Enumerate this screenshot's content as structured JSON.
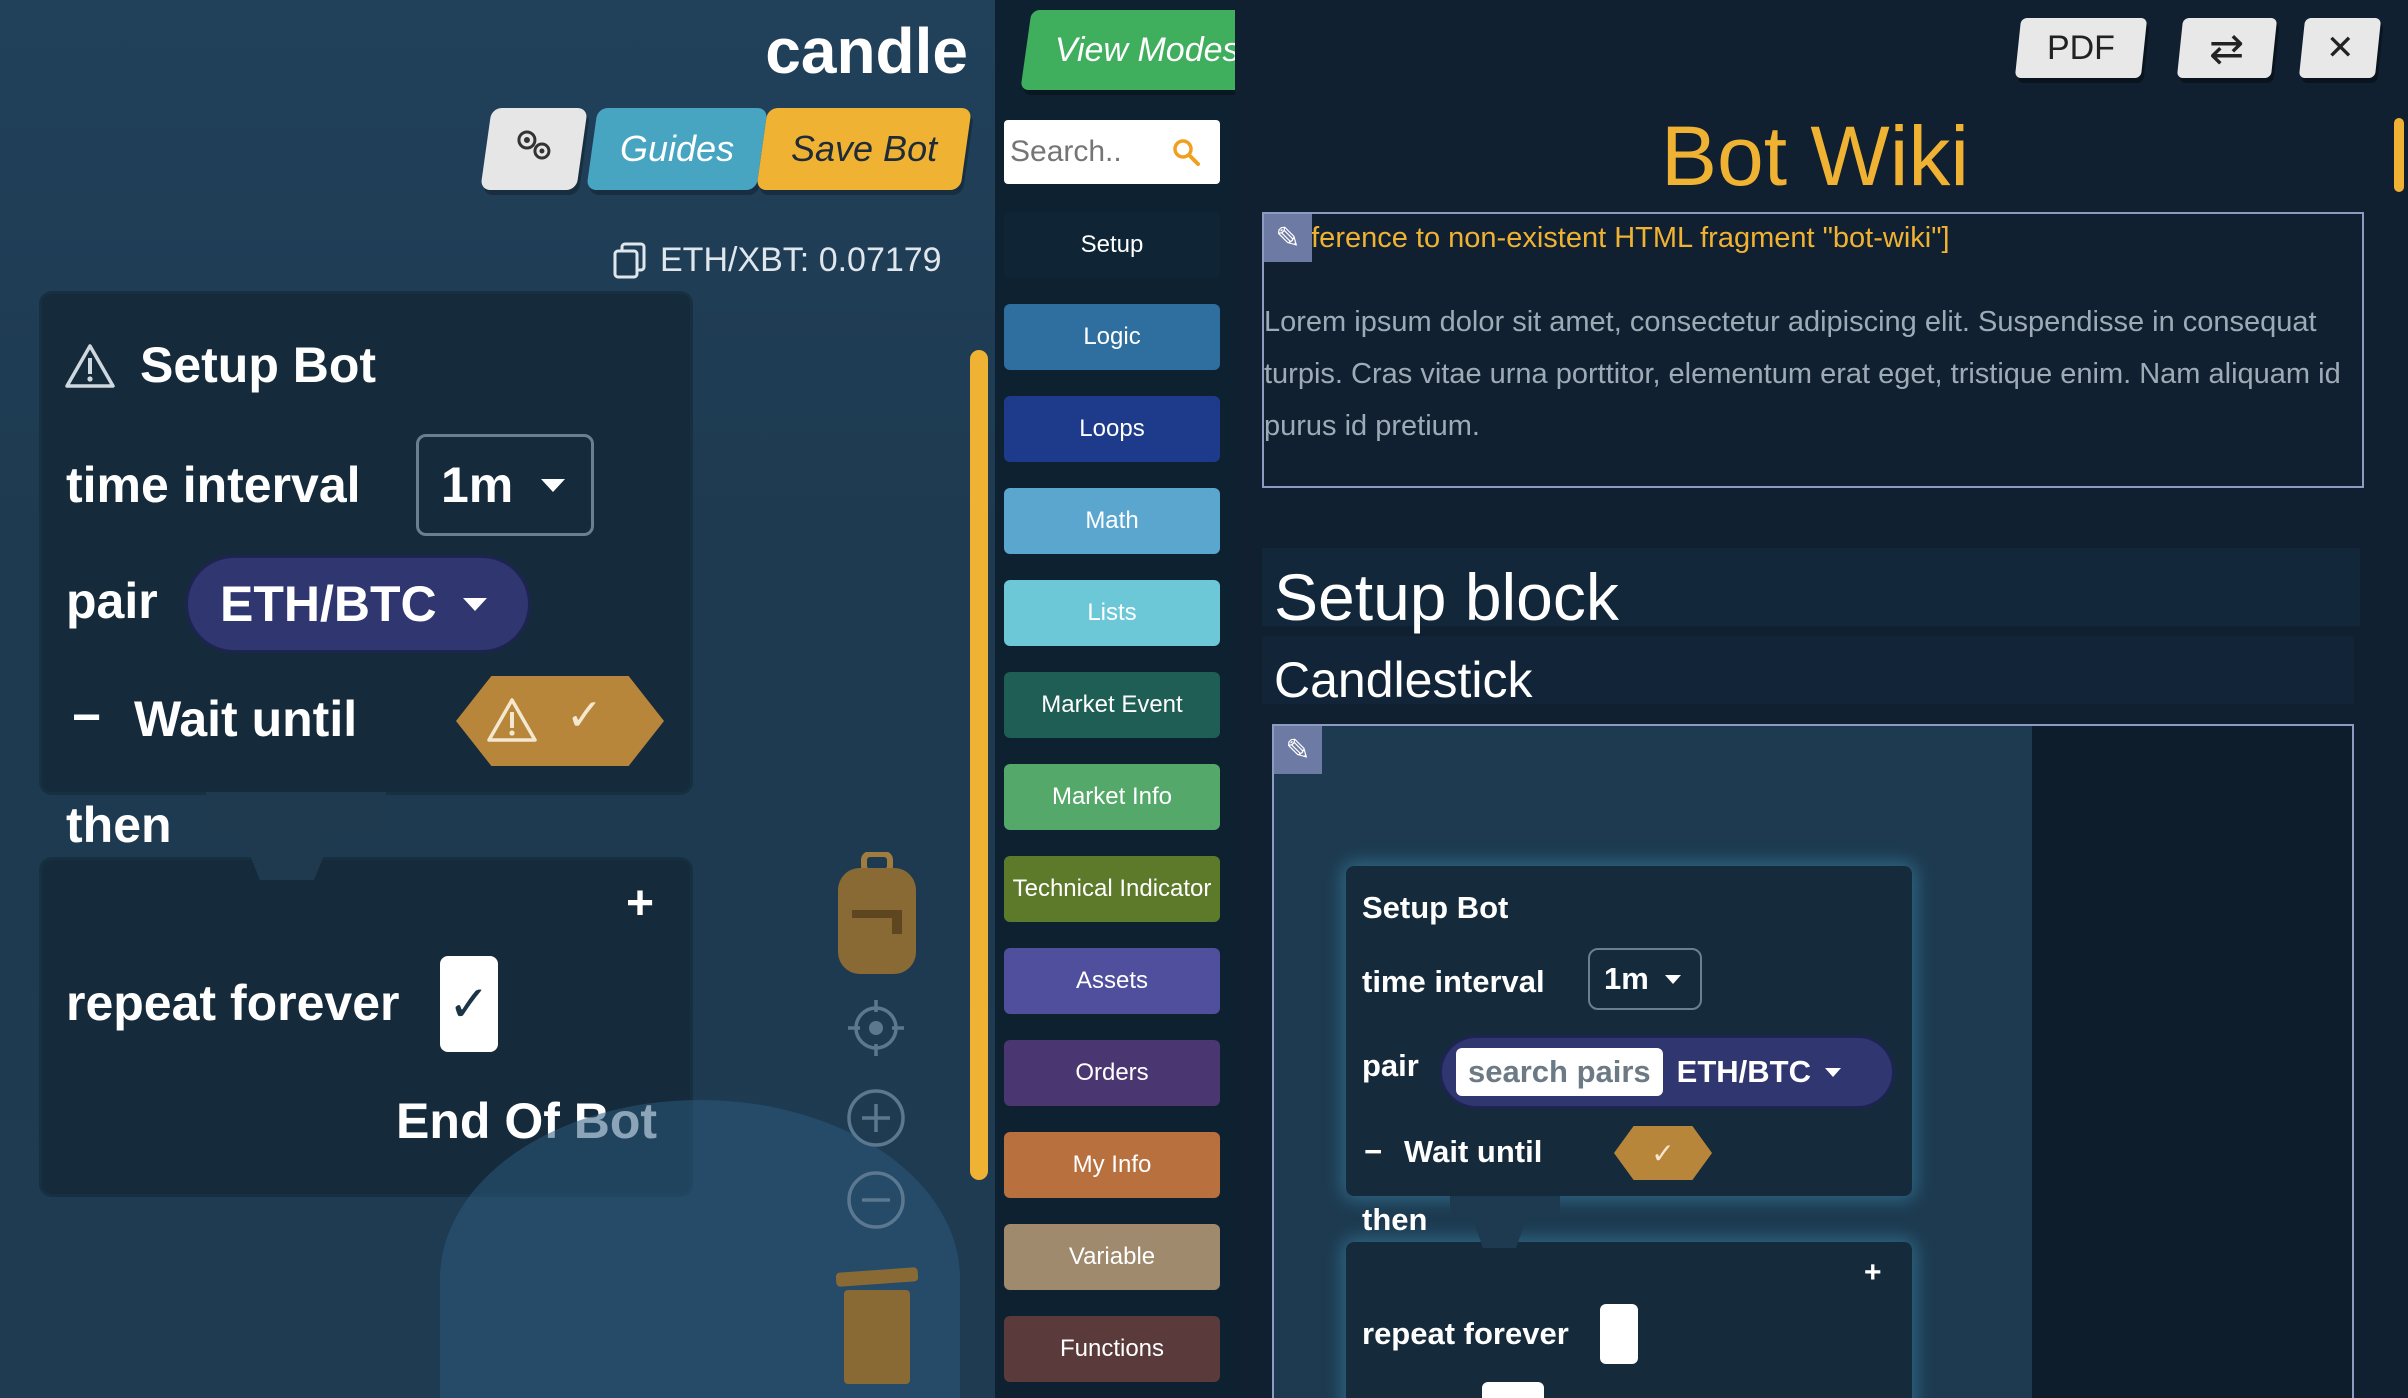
{
  "workspace": {
    "bot_name": "candle",
    "toolbar": {
      "guides_label": "Guides",
      "save_label": "Save Bot"
    },
    "price_text": "ETH/XBT: 0.07179",
    "setup_block": {
      "title": "Setup Bot",
      "time_interval_label": "time interval",
      "time_interval_value": "1m",
      "pair_label": "pair",
      "pair_value": "ETH/BTC",
      "collapse_symbol": "−",
      "wait_until_label": "Wait until",
      "check_symbol": "✓",
      "then_label": "then",
      "add_symbol": "+",
      "repeat_label": "repeat forever",
      "repeat_check": "✓",
      "end_label": "End Of Bot"
    }
  },
  "categories": {
    "view_modes_label": "View Modes",
    "search_placeholder": "Search..",
    "items": [
      {
        "label": "Setup",
        "color": "#0f2535"
      },
      {
        "label": "Logic",
        "color": "#2f6f9f"
      },
      {
        "label": "Loops",
        "color": "#1e3a8a"
      },
      {
        "label": "Math",
        "color": "#5aa6cf"
      },
      {
        "label": "Lists",
        "color": "#6cc7d6"
      },
      {
        "label": "Market Event",
        "color": "#1f5e55"
      },
      {
        "label": "Market Info",
        "color": "#54a86a"
      },
      {
        "label": "Technical Indicator",
        "color": "#5d7a2a"
      },
      {
        "label": "Assets",
        "color": "#4f4f9e"
      },
      {
        "label": "Orders",
        "color": "#4a3670"
      },
      {
        "label": "My Info",
        "color": "#b8703f"
      },
      {
        "label": "Variable",
        "color": "#a08a6e"
      },
      {
        "label": "Functions",
        "color": "#5a3a3a"
      }
    ]
  },
  "wiki": {
    "pdf_label": "PDF",
    "swap_symbol": "⇄",
    "close_symbol": "✕",
    "title": "Bot Wiki",
    "fragment_reference": "[Reference to non-existent HTML fragment \"bot-wiki\"]",
    "lorem": "Lorem ipsum dolor sit amet, consectetur adipiscing elit. Suspendisse in consequat turpis. Cras vitae urna porttitor, elementum erat eget, tristique enim. Nam aliquam id purus id pretium.",
    "section_title": "Setup block",
    "subsection_title": "Candlestick",
    "preview": {
      "title": "Setup Bot",
      "time_interval_label": "time interval",
      "time_interval_value": "1m",
      "pair_label": "pair",
      "search_placeholder": "search pairs",
      "pair_value": "ETH/BTC",
      "collapse_symbol": "−",
      "wait_until_label": "Wait until",
      "check_symbol": "✓",
      "then_label": "then",
      "add_symbol": "+",
      "repeat_label": "repeat forever"
    }
  }
}
